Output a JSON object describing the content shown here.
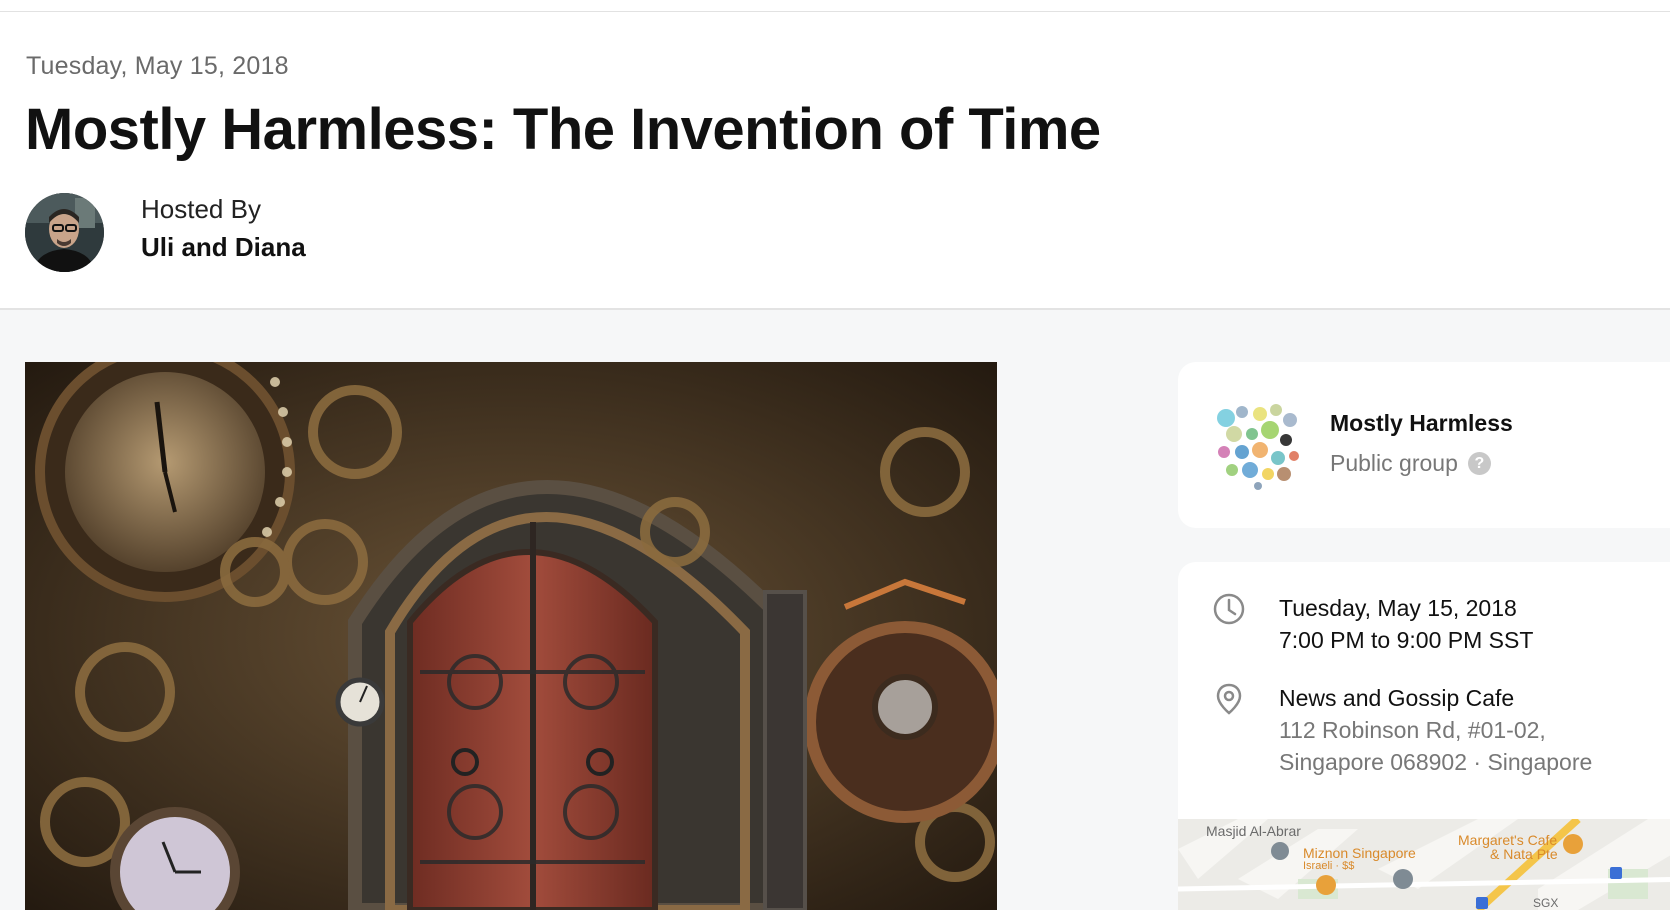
{
  "event": {
    "date": "Tuesday, May 15, 2018",
    "title": "Mostly Harmless: The Invention of Time"
  },
  "host": {
    "label": "Hosted By",
    "name": "Uli and Diana"
  },
  "group": {
    "name": "Mostly Harmless",
    "type": "Public group",
    "help": "?"
  },
  "details": {
    "date": "Tuesday, May 15, 2018",
    "time": "7:00 PM to 9:00 PM SST",
    "venue": "News and Gossip Cafe",
    "address_line1": "112 Robinson Rd, #01-02,",
    "address_line2": "Singapore 068902 · Singapore"
  },
  "map": {
    "place1": "Masjid Al-Abrar",
    "place2": "Miznon Singapore",
    "place2_sub": "Israeli · $$",
    "place3_line1": "Margaret's Cafe",
    "place3_line2": "& Nata Pte",
    "place4": "SGX"
  },
  "colors": {
    "accent_map_yellow": "#f4c54a",
    "map_marker_orange": "#e8a13a",
    "map_marker_gray": "#7f8b94",
    "text_muted": "#777777"
  }
}
